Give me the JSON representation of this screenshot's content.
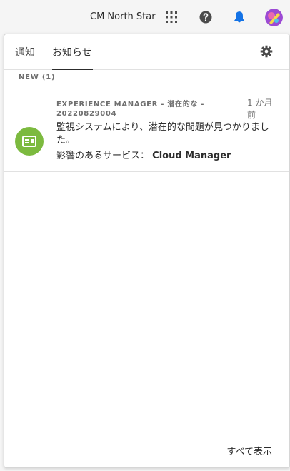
{
  "header": {
    "org_name": "CM North Star",
    "icons": [
      "apps-grid-icon",
      "help-icon",
      "bell-icon",
      "avatar"
    ],
    "accent_color": "#1473e6"
  },
  "panel": {
    "tabs": [
      {
        "label": "通知"
      },
      {
        "label": "お知らせ",
        "selected": true
      }
    ],
    "settings_icon": "gear-icon",
    "section_label": "NEW (1)",
    "notifications": [
      {
        "title_line1": "EXPERIENCE MANAGER - 潜在的な -",
        "title_line2": "20220829004",
        "time": "1 か月前",
        "message": "監視システムにより、潜在的な問題が見つかりました。",
        "service_label": "影響のあるサービス：",
        "service_value": "Cloud Manager",
        "icon": "news-icon",
        "icon_color": "#7cba3f"
      }
    ],
    "footer": {
      "show_all_label": "すべて表示"
    }
  }
}
